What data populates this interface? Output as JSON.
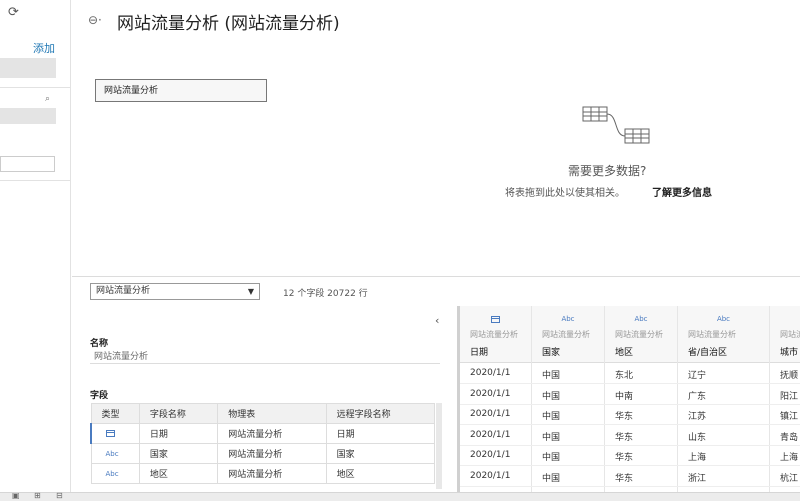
{
  "sidebar": {
    "refresh_icon": "refresh-icon",
    "add_label": "添加"
  },
  "canvas": {
    "title": "网站流量分析 (网站流量分析)",
    "table_name": "网站流量分析",
    "need_more": "需要更多数据?",
    "hint": "将表拖到此处以使其相关。",
    "learn_more": "了解更多信息"
  },
  "bottom": {
    "table_select_value": "网站流量分析",
    "field_count": "12 个字段 20722 行",
    "name_label": "名称",
    "name_value": "网站流量分析",
    "fields_label": "字段",
    "fields_headers": [
      "类型",
      "字段名称",
      "物理表",
      "远程字段名称"
    ],
    "fields_rows": [
      {
        "type": "date-icon",
        "name": "日期",
        "table": "网站流量分析",
        "remote": "日期"
      },
      {
        "type": "Abc",
        "name": "国家",
        "table": "网站流量分析",
        "remote": "国家"
      },
      {
        "type": "Abc",
        "name": "地区",
        "table": "网站流量分析",
        "remote": "地区"
      }
    ]
  },
  "grid": {
    "columns": [
      {
        "type": "date-icon",
        "source": "网站流量分析",
        "name": "日期"
      },
      {
        "type": "Abc",
        "source": "网站流量分析",
        "name": "国家"
      },
      {
        "type": "Abc",
        "source": "网站流量分析",
        "name": "地区"
      },
      {
        "type": "Abc",
        "source": "网站流量分析",
        "name": "省/自治区"
      },
      {
        "type": "Abc",
        "source": "网站流量分析",
        "name": "城市"
      }
    ],
    "rows": [
      [
        "2020/1/1",
        "中国",
        "东北",
        "辽宁",
        "抚顺"
      ],
      [
        "2020/1/1",
        "中国",
        "中南",
        "广东",
        "阳江"
      ],
      [
        "2020/1/1",
        "中国",
        "华东",
        "江苏",
        "镇江"
      ],
      [
        "2020/1/1",
        "中国",
        "华东",
        "山东",
        "青岛"
      ],
      [
        "2020/1/1",
        "中国",
        "华东",
        "上海",
        "上海"
      ],
      [
        "2020/1/1",
        "中国",
        "华东",
        "浙江",
        "杭江"
      ]
    ]
  },
  "colors": {
    "accent": "#1f77b4",
    "type_icon": "#4a7bc0"
  }
}
